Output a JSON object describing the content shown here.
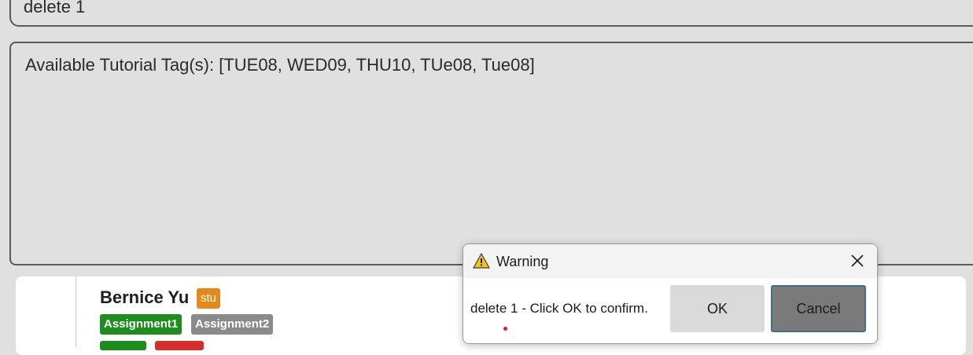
{
  "command": {
    "text": "delete 1"
  },
  "result": {
    "text": "Available Tutorial Tag(s): [TUE08, WED09, THU10, TUe08, Tue08]"
  },
  "person_card": {
    "name": "Bernice Yu",
    "role_tag": "stu",
    "tags": [
      "Assignment1",
      "Assignment2"
    ],
    "colors": {
      "role": "#e5891b",
      "assignment_done": "#1e8d1e",
      "assignment_pending": "#8a8a8a",
      "row2_green": "#1e8d1e",
      "row2_red": "#d62d2d"
    }
  },
  "dialog": {
    "title": "Warning",
    "icon": "warning-icon",
    "message": "delete 1 - Click OK to confirm.",
    "ok_label": "OK",
    "cancel_label": "Cancel"
  }
}
